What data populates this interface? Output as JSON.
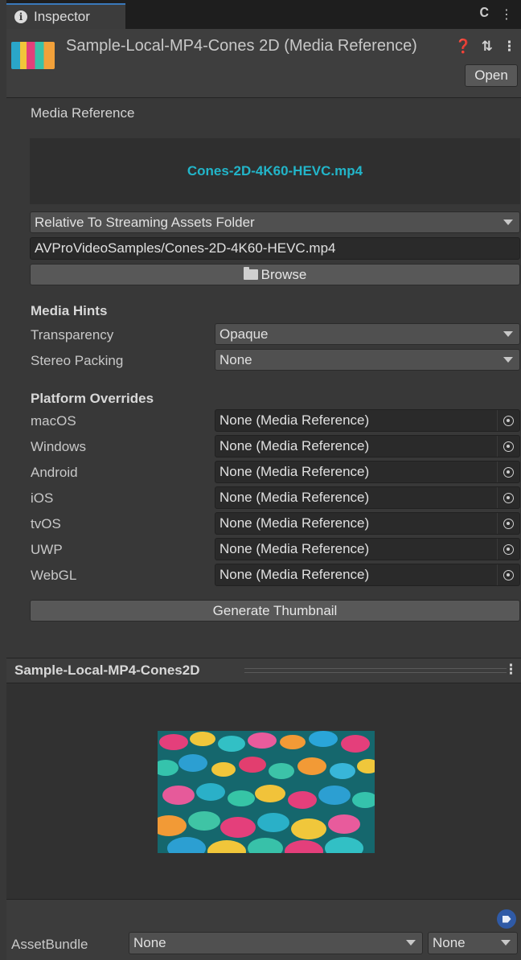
{
  "tab": {
    "label": "Inspector"
  },
  "header": {
    "title": "Sample-Local-MP4-Cones 2D (Media Reference)",
    "open_label": "Open"
  },
  "media": {
    "section_label": "Media Reference",
    "filename": "Cones-2D-4K60-HEVC.mp4",
    "location": "Relative To Streaming Assets Folder",
    "path": "AVProVideoSamples/Cones-2D-4K60-HEVC.mp4",
    "browse_label": "Browse"
  },
  "hints": {
    "heading": "Media Hints",
    "transparency_label": "Transparency",
    "transparency_value": "Opaque",
    "stereo_label": "Stereo Packing",
    "stereo_value": "None"
  },
  "overrides": {
    "heading": "Platform Overrides",
    "rows": [
      {
        "platform": "macOS",
        "value": "None (Media Reference)"
      },
      {
        "platform": "Windows",
        "value": "None (Media Reference)"
      },
      {
        "platform": "Android",
        "value": "None (Media Reference)"
      },
      {
        "platform": "iOS",
        "value": "None (Media Reference)"
      },
      {
        "platform": "tvOS",
        "value": "None (Media Reference)"
      },
      {
        "platform": "UWP",
        "value": "None (Media Reference)"
      },
      {
        "platform": "WebGL",
        "value": "None (Media Reference)"
      }
    ]
  },
  "generate_label": "Generate Thumbnail",
  "preview": {
    "title": "Sample-Local-MP4-Cones2D"
  },
  "asset_bundle": {
    "label": "AssetBundle",
    "name_value": "None",
    "variant_value": "None"
  },
  "colors": {
    "accent": "#22b5c9",
    "tab_highlight": "#3a79bb",
    "panel_bg": "#383838",
    "tag_blue": "#2f5aa6"
  }
}
